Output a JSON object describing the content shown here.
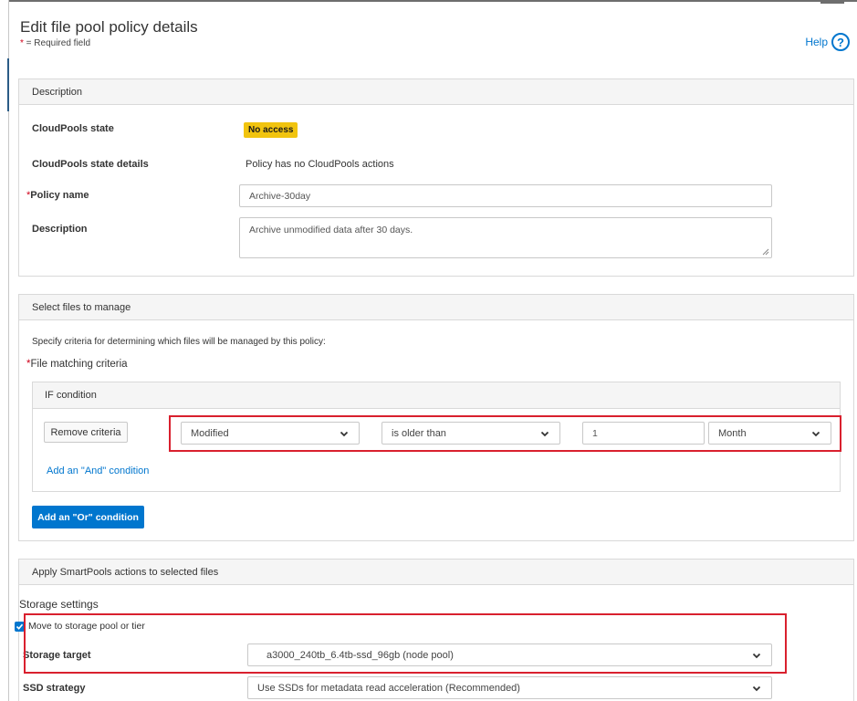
{
  "header": {
    "title": "Edit file pool policy details",
    "required_star": "*",
    "required_note": " = Required field",
    "help_label": "Help",
    "help_glyph": "?"
  },
  "description_section": {
    "title": "Description",
    "cloudpools_state_label": "CloudPools state",
    "cloudpools_state_value": "No access",
    "cloudpools_details_label": "CloudPools state details",
    "cloudpools_details_value": "Policy has no CloudPools actions",
    "policy_name_label": "Policy name",
    "policy_name_value": "Archive-30day",
    "description_label": "Description",
    "description_value": "Archive unmodified data after 30 days."
  },
  "files_section": {
    "title": "Select files to manage",
    "instruction": "Specify criteria for determining which files will be managed by this policy:",
    "criteria_label": "File matching criteria",
    "if_condition_title": "IF condition",
    "remove_button": "Remove criteria",
    "attribute_select": "Modified",
    "operator_select": "is older than",
    "amount_value": "1",
    "unit_select": "Month",
    "add_and_link": "Add an \"And\" condition",
    "add_or_button": "Add an \"Or\" condition"
  },
  "actions_section": {
    "title": "Apply SmartPools actions to selected files",
    "storage_settings_heading": "Storage settings",
    "move_checkbox_label": "Move to storage pool or tier",
    "move_checked": true,
    "storage_target_label": "Storage target",
    "storage_target_value": "a3000_240tb_6.4tb-ssd_96gb (node pool)",
    "ssd_strategy_label": "SSD strategy",
    "ssd_strategy_value": "Use SSDs for metadata read acceleration (Recommended)"
  },
  "colors": {
    "accent": "#0076ce",
    "badge": "#f1c40f",
    "highlight_border": "#d9202e",
    "required": "#d0021b"
  }
}
